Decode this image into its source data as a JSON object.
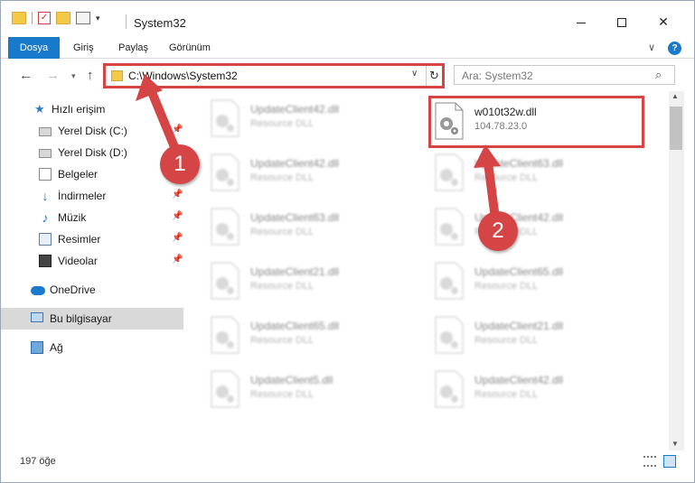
{
  "titlebar": {
    "title": "System32",
    "minimize_icon": "minimize-icon",
    "maximize_icon": "maximize-icon",
    "close_icon": "close-icon",
    "close_glyph": "✕"
  },
  "ribbon": {
    "tabs": [
      "Dosya",
      "Giriş",
      "Paylaş",
      "Görünüm"
    ],
    "help": "?"
  },
  "navigation": {
    "address": "C:\\Windows\\System32",
    "search_placeholder": "Ara: System32"
  },
  "sidebar": {
    "items": [
      {
        "label": "Hızlı erişim",
        "icon": "star-icon"
      },
      {
        "label": "Yerel Disk (C:)",
        "icon": "disk-icon"
      },
      {
        "label": "Yerel Disk (D:)",
        "icon": "disk-icon"
      },
      {
        "label": "Belgeler",
        "icon": "documents-icon"
      },
      {
        "label": "İndirmeler",
        "icon": "downloads-icon"
      },
      {
        "label": "Müzik",
        "icon": "music-icon"
      },
      {
        "label": "Resimler",
        "icon": "pictures-icon"
      },
      {
        "label": "Videolar",
        "icon": "videos-icon"
      },
      {
        "label": "OneDrive",
        "icon": "cloud-icon"
      },
      {
        "label": "Bu bilgisayar",
        "icon": "computer-icon"
      },
      {
        "label": "Ağ",
        "icon": "network-icon"
      }
    ]
  },
  "files": {
    "left": [
      {
        "name": "UpdateClient42.dll",
        "desc": "Resource DLL"
      },
      {
        "name": "UpdateClient42.dll",
        "desc": "Resource DLL"
      },
      {
        "name": "UpdateClient63.dll",
        "desc": "Resource DLL"
      },
      {
        "name": "UpdateClient21.dll",
        "desc": "Resource DLL"
      },
      {
        "name": "UpdateClient65.dll",
        "desc": "Resource DLL"
      },
      {
        "name": "UpdateClient5.dll",
        "desc": "Resource DLL"
      }
    ],
    "right": [
      {
        "name": "w010t32w.dll",
        "desc": "104.78.23.0"
      },
      {
        "name": "UpdateClient63.dll",
        "desc": "Resource DLL"
      },
      {
        "name": "UpdateClient42.dll",
        "desc": "Resource DLL"
      },
      {
        "name": "UpdateClient65.dll",
        "desc": "Resource DLL"
      },
      {
        "name": "UpdateClient21.dll",
        "desc": "Resource DLL"
      },
      {
        "name": "UpdateClient42.dll",
        "desc": "Resource DLL"
      }
    ]
  },
  "status": {
    "count": "197 öğe"
  },
  "annotations": {
    "step1": "1",
    "step2": "2",
    "color": "#d64545"
  }
}
